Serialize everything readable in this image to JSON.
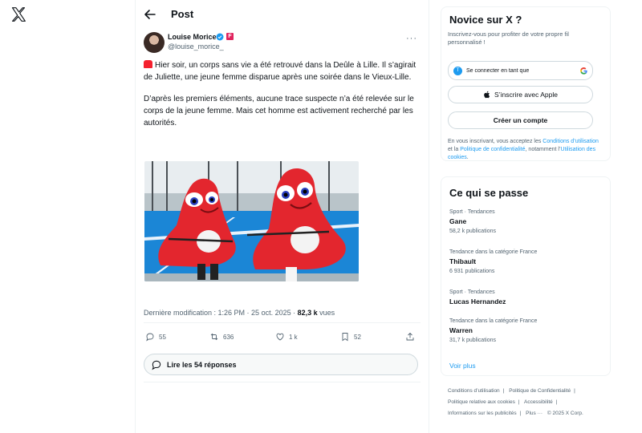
{
  "header": {
    "title": "Post"
  },
  "author": {
    "name": "Louise Morice",
    "handle": "@louise_morice_",
    "badge_letter": "F"
  },
  "tweet": {
    "paragraph1": "Hier soir, un corps sans vie a été retrouvé dans la Deûle à Lille. Il s’agirait de Juliette, une jeune femme disparue après une soirée dans le Vieux-Lille.",
    "paragraph2": "D’après les premiers éléments, aucune trace suspecte n’a été relevée sur le corps de la jeune femme. Mais cet homme est activement recherché par les autorités.",
    "meta_prefix": "Dernière modification : 1:26 PM · 25 oct. 2025 · ",
    "views_count": "82,3 k",
    "views_label": " vues"
  },
  "actions": {
    "replies": "55",
    "reposts": "636",
    "likes": "1 k",
    "bookmarks": "52"
  },
  "read_replies": "Lire les 54 réponses",
  "signup": {
    "title": "Novice sur X ?",
    "description": "Inscrivez-vous pour profiter de votre propre fil personnalisé !",
    "google_label": "Se connecter en tant que",
    "apple_label": "S’inscrire avec Apple",
    "create_label": "Créer un compte",
    "legal_prefix": "En vous inscrivant, vous acceptez les ",
    "legal_terms": "Conditions d’utilisation",
    "legal_and": " et la ",
    "legal_privacy": "Politique de confidentialité",
    "legal_mid": ", notamment l’",
    "legal_cookies": "Utilisation des cookies",
    "legal_end": "."
  },
  "trends": {
    "title": "Ce qui se passe",
    "items": [
      {
        "context": "Sport · Tendances",
        "name": "Gane",
        "count": "58,2 k publications"
      },
      {
        "context": "Tendance dans la catégorie France",
        "name": "Thibault",
        "count": "6 931 publications"
      },
      {
        "context": "Sport · Tendances",
        "name": "Lucas Hernandez",
        "count": ""
      },
      {
        "context": "Tendance dans la catégorie France",
        "name": "Warren",
        "count": "31,7 k publications"
      }
    ],
    "see_more": "Voir plus"
  },
  "footer": {
    "links": [
      "Conditions d’utilisation",
      "|",
      "Politique de Confidentialité",
      "|",
      "Politique relative aux cookies",
      "|",
      "Accessibilité",
      "|",
      "Informations sur les publicités",
      "|",
      "Plus ···",
      "© 2025 X Corp."
    ]
  },
  "colors": {
    "accent": "#1d9bf0",
    "mascot_red": "#e3262e",
    "court_blue": "#1b86d6"
  }
}
